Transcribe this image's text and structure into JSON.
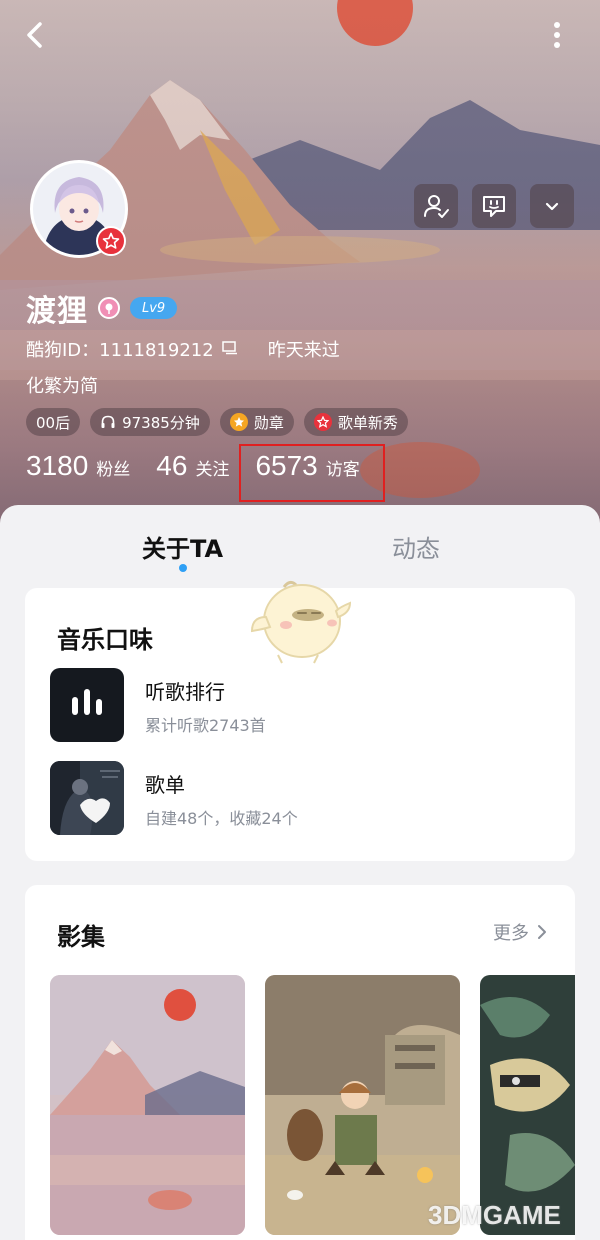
{
  "header": {
    "back_icon": "chevron-left-icon",
    "more_icon": "vertical-dots-icon",
    "actions": [
      "follow-user-icon",
      "message-icon",
      "chevron-down-icon"
    ]
  },
  "profile": {
    "name": "渡狸",
    "level": "Lv9",
    "id_label": "酷狗ID：1111819212",
    "last_visit": "昨天来过",
    "signature": "化繁为简",
    "tags": [
      {
        "label": "00后"
      },
      {
        "label": "97385分钟"
      },
      {
        "label": "勋章"
      },
      {
        "label": "歌单新秀"
      }
    ],
    "stats": [
      {
        "value": "3180",
        "label": "粉丝"
      },
      {
        "value": "46",
        "label": "关注"
      },
      {
        "value": "6573",
        "label": "访客"
      }
    ]
  },
  "tabs": [
    {
      "label": "关于TA",
      "active": true
    },
    {
      "label": "动态",
      "active": false
    }
  ],
  "music_taste": {
    "title": "音乐口味",
    "items": [
      {
        "title": "听歌排行",
        "subtitle": "累计听歌2743首"
      },
      {
        "title": "歌单",
        "subtitle": "自建48个，收藏24个"
      }
    ]
  },
  "album": {
    "title": "影集",
    "more_label": "更多"
  },
  "watermark": "3DMGAME",
  "colors": {
    "accent_blue": "#2fa0f5",
    "level_badge": "#45a7f0",
    "highlight_red": "#e02020",
    "badge_red": "#e8323c"
  }
}
